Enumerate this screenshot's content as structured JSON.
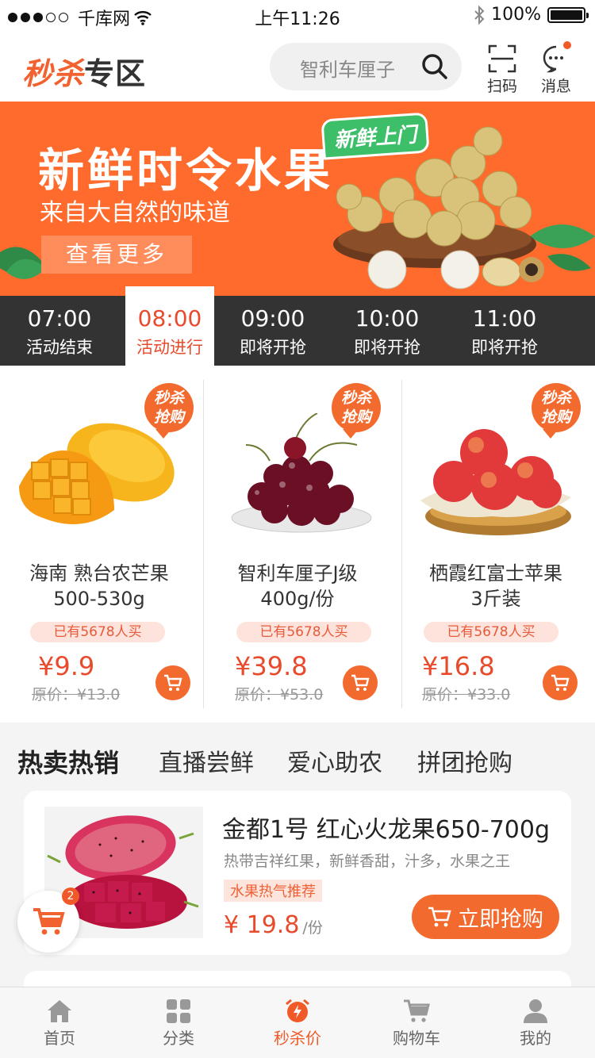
{
  "status_bar": {
    "carrier": "千库网",
    "time": "上午11:26",
    "battery": "100%"
  },
  "header": {
    "logo_highlight": "秒杀",
    "logo_rest": "专区",
    "search_placeholder": "智利车厘子",
    "scan_label": "扫码",
    "message_label": "消息"
  },
  "banner": {
    "title": "新鲜时令水果",
    "subtitle": "来自大自然的味道",
    "button": "查看更多",
    "tag": "新鲜上门"
  },
  "time_tabs": [
    {
      "time": "07:00",
      "status": "活动结束"
    },
    {
      "time": "08:00",
      "status": "活动进行"
    },
    {
      "time": "09:00",
      "status": "即将开抢"
    },
    {
      "time": "10:00",
      "status": "即将开抢"
    },
    {
      "time": "11:00",
      "status": "即将开抢"
    }
  ],
  "flash_badge": "秒杀\n抢购",
  "flash_badge_l1": "秒杀",
  "flash_badge_l2": "抢购",
  "products": [
    {
      "name_l1": "海南 熟台农芒果",
      "name_l2": "500-530g",
      "sold": "已有5678人买",
      "price": "¥9.9",
      "original": "原价：¥13.0"
    },
    {
      "name_l1": "智利车厘子J级",
      "name_l2": "400g/份",
      "sold": "已有5678人买",
      "price": "¥39.8",
      "original": "原价：¥53.0"
    },
    {
      "name_l1": "栖霞红富士苹果",
      "name_l2": "3斤装",
      "sold": "已有5678人买",
      "price": "¥16.8",
      "original": "原价：¥33.0"
    }
  ],
  "categories": [
    "热卖热销",
    "直播尝鲜",
    "爱心助农",
    "拼团抢购"
  ],
  "hot_item": {
    "title": "金都1号 红心火龙果650-700g",
    "desc": "热带吉祥红果，新鲜香甜，汁多，水果之王",
    "tag": "水果热气推荐",
    "price": "¥ 19.8",
    "unit": "/份",
    "button": "立即抢购"
  },
  "floating_cart_count": "2",
  "bottom_nav": [
    {
      "label": "首页",
      "icon": "home-icon"
    },
    {
      "label": "分类",
      "icon": "grid-icon"
    },
    {
      "label": "秒杀价",
      "icon": "alarm-clock-icon"
    },
    {
      "label": "购物车",
      "icon": "cart-icon"
    },
    {
      "label": "我的",
      "icon": "user-icon"
    }
  ],
  "colors": {
    "accent": "#f26230",
    "banner": "#ff6b2c",
    "dark_bar": "#333333",
    "green_tag": "#3dbf6a"
  }
}
